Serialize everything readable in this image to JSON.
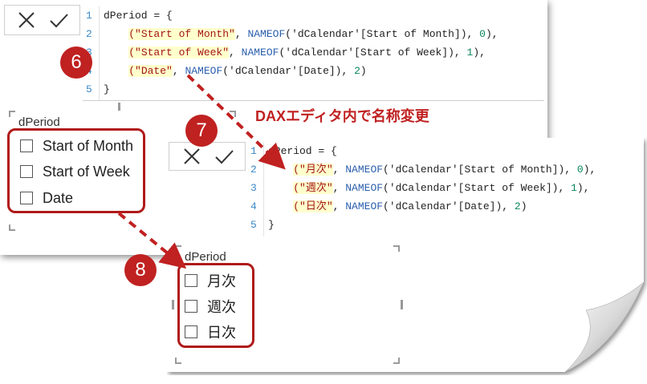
{
  "colors": {
    "accent_red": "#c02121",
    "code_keyword": "#2b5fad",
    "code_string": "#a31515",
    "code_number": "#098658",
    "line_number": "#3a88c8"
  },
  "icons": {
    "cancel": "close-icon",
    "commit": "checkmark-icon"
  },
  "annotation_text": "DAXエディタ内で名称変更",
  "badges": [
    "6",
    "7",
    "8"
  ],
  "editor_a": {
    "line_numbers": [
      "1",
      "2",
      "3",
      "4",
      "5"
    ],
    "line1": "dPeriod = {",
    "rows": [
      {
        "label": "(\"Start of Month\"",
        "fn": "NAMEOF",
        "arg": "('dCalendar'[Start of Month])",
        "num": "0",
        "tail": "),"
      },
      {
        "label": "(\"Start of Week\"",
        "fn": "NAMEOF",
        "arg": "('dCalendar'[Start of Week])",
        "num": "1",
        "tail": "),"
      },
      {
        "label": "(\"Date\"",
        "fn": "NAMEOF",
        "arg": "('dCalendar'[Date])",
        "num": "2",
        "tail": ")"
      }
    ],
    "line5": "}"
  },
  "editor_b": {
    "line_numbers": [
      "1",
      "2",
      "3",
      "4",
      "5"
    ],
    "line1": "dPeriod = {",
    "rows": [
      {
        "label": "(\"月次\"",
        "fn": "NAMEOF",
        "arg": "('dCalendar'[Start of Month])",
        "num": "0",
        "tail": "),"
      },
      {
        "label": "(\"週次\"",
        "fn": "NAMEOF",
        "arg": "('dCalendar'[Start of Week])",
        "num": "1",
        "tail": "),"
      },
      {
        "label": "(\"日次\"",
        "fn": "NAMEOF",
        "arg": "('dCalendar'[Date])",
        "num": "2",
        "tail": ")"
      }
    ],
    "line5": "}"
  },
  "slicer_a": {
    "title": "dPeriod",
    "items": [
      "Start of Month",
      "Start of Week",
      "Date"
    ]
  },
  "slicer_b": {
    "title": "dPeriod",
    "items": [
      "月次",
      "週次",
      "日次"
    ]
  }
}
